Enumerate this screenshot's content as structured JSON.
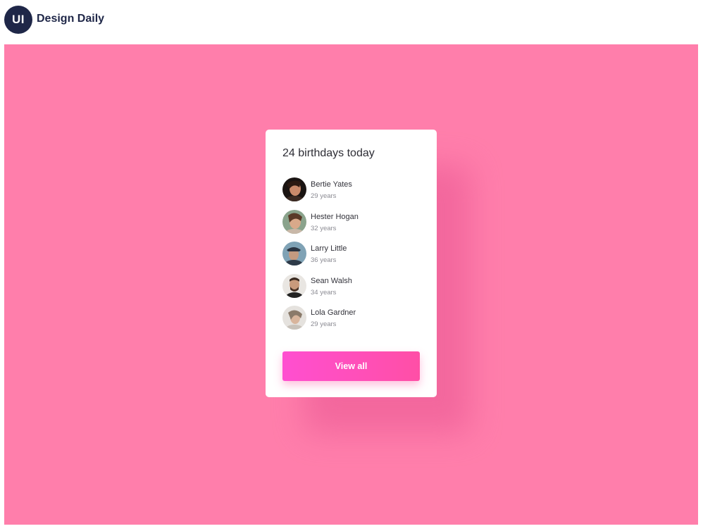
{
  "brand": {
    "logo_text": "UI",
    "name": "Design Daily"
  },
  "card": {
    "title": "24 birthdays today",
    "people": [
      {
        "name": "Bertie Yates",
        "age": "29 years",
        "avatar": "avatar-photo"
      },
      {
        "name": "Hester Hogan",
        "age": "32 years",
        "avatar": "avatar-photo"
      },
      {
        "name": "Larry Little",
        "age": "36 years",
        "avatar": "avatar-photo"
      },
      {
        "name": "Sean Walsh",
        "age": "34 years",
        "avatar": "avatar-photo"
      },
      {
        "name": "Lola Gardner",
        "age": "29 years",
        "avatar": "avatar-photo"
      }
    ],
    "button_label": "View all"
  },
  "colors": {
    "background": "#ff7eab",
    "brand_navy": "#1f2748",
    "button_gradient_start": "#ff4fd0",
    "button_gradient_end": "#ff4fa6"
  }
}
